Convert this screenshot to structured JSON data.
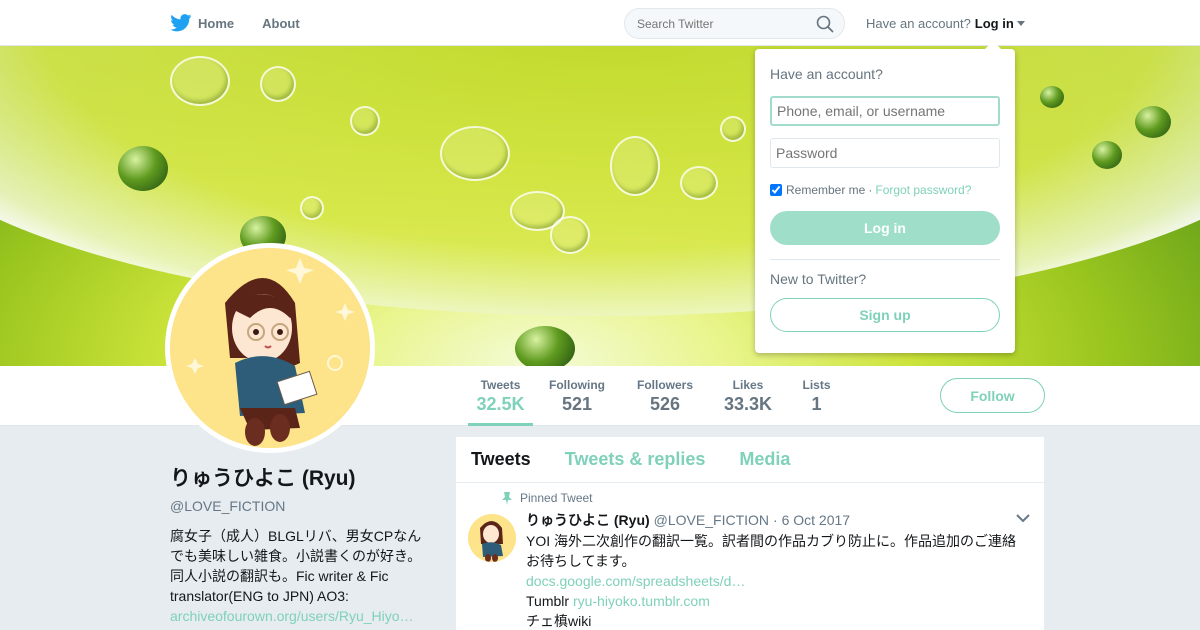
{
  "nav": {
    "home_label": "Home",
    "about_label": "About",
    "search_placeholder": "Search Twitter",
    "have_account": "Have an account?",
    "login_label": "Log in"
  },
  "profile_nav": {
    "stats": [
      {
        "label": "Tweets",
        "value": "32.5K"
      },
      {
        "label": "Following",
        "value": "521"
      },
      {
        "label": "Followers",
        "value": "526"
      },
      {
        "label": "Likes",
        "value": "33.3K"
      },
      {
        "label": "Lists",
        "value": "1"
      }
    ],
    "follow_label": "Follow"
  },
  "profile": {
    "name": "りゅうひよこ (Ryu)",
    "handle": "@LOVE_FICTION",
    "bio_text": "腐女子（成人）BLGLリバ、男女CPなんでも美味しい雑食。小説書くのが好き。同人小説の翻訳も。Fic writer & Fic translator(ENG to JPN) AO3:",
    "bio_link": "archiveofourown.org/users/Ryu_Hiyo…"
  },
  "timeline": {
    "tabs": [
      "Tweets",
      "Tweets & replies",
      "Media"
    ],
    "pinned_label": "Pinned Tweet",
    "tweet": {
      "name": "りゅうひよこ (Ryu)",
      "handle": "@LOVE_FICTION",
      "date": "· 6 Oct 2017",
      "text": "YOI 海外二次創作の翻訳一覧。訳者間の作品カブり防止に。作品追加のご連絡お待ちしてます。",
      "link": "docs.google.com/spreadsheets/d…",
      "line2_prefix": "Tumblr",
      "line2_link": "ryu-hiyoko.tumblr.com",
      "line3": "チェ槙wiki"
    }
  },
  "login_dropdown": {
    "title": "Have an account?",
    "username_placeholder": "Phone, email, or username",
    "password_placeholder": "Password",
    "remember_label": "Remember me",
    "separator": "·",
    "forgot_label": "Forgot password?",
    "login_button": "Log in",
    "new_text": "New to Twitter?",
    "signup_button": "Sign up"
  },
  "colors": {
    "accent": "#7fd1b9",
    "twitter_blue": "#1da1f2"
  }
}
